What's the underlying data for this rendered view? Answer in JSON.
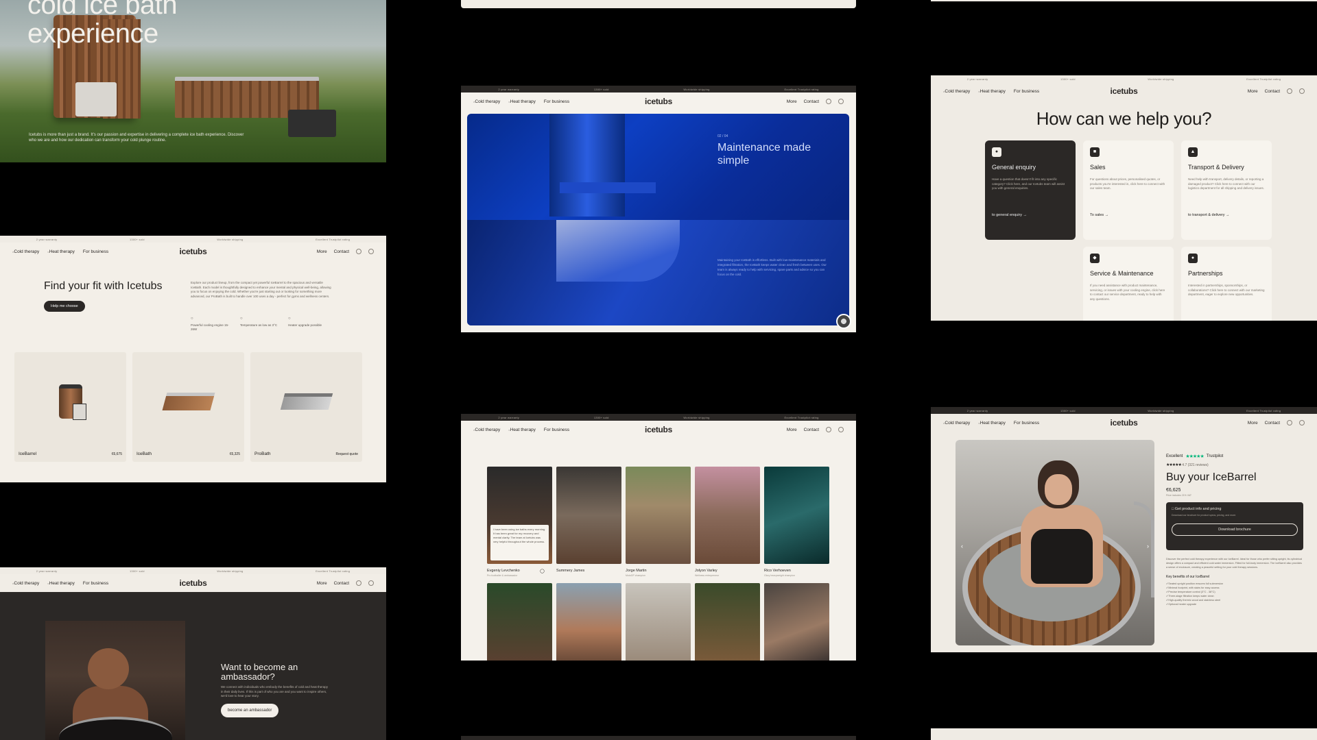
{
  "topbar": [
    "2 year warranty",
    "1300+ sold",
    "Worldwide shipping",
    "Excellent Trustpilot rating"
  ],
  "nav": {
    "left": [
      "Cold therapy",
      "Heat therapy",
      "For business"
    ],
    "logo": "icetubs",
    "right": [
      "More",
      "Contact"
    ]
  },
  "hero": {
    "title": "cold ice bath\nexperience",
    "caption": "Icetubs is more than just a brand. It's our passion and expertise in delivering a complete ice bath experience. Discover who we are and how our dedication can transform your cold plunge routine."
  },
  "maintenance": {
    "eyebrow": "02 / 04",
    "heading": "Maintenance made simple",
    "body": "Maintaining your IceBath is effortless. Built with low-maintenance materials and integrated filtration, the IceBath keeps water clean and fresh between uses. Our team is always ready to help with servicing, spare parts and advice so you can focus on the cold."
  },
  "help": {
    "heading": "How can we help you?",
    "cards": [
      {
        "icon": "chat-icon",
        "title": "General enquiry",
        "body": "Have a question that doesn't fit into any specific category? Click here, and our Icetubs team will assist you with general enquiries.",
        "link": "to general enquiry →"
      },
      {
        "icon": "cart-icon",
        "title": "Sales",
        "body": "For questions about prices, personalised quotes, or products you're interested in, click here to connect with our sales team.",
        "link": "To sales →"
      },
      {
        "icon": "truck-icon",
        "title": "Transport & Delivery",
        "body": "Need help with transport, delivery details, or reporting a damaged product? Click here to connect with our logistics department for all shipping and delivery issues.",
        "link": "to transport & delivery →"
      },
      {
        "icon": "wrench-icon",
        "title": "Service & Maintenance",
        "body": "If you need assistance with product maintenance, servicing, or issues with your cooling engine, click here to contact our service department, ready to help with any questions.",
        "link": ""
      },
      {
        "icon": "handshake-icon",
        "title": "Partnerships",
        "body": "Interested in partnerships, sponsorships, or collaborations? Click here to connect with our marketing department, eager to explore new opportunities.",
        "link": ""
      }
    ]
  },
  "fit": {
    "heading": "Find your fit with Icetubs",
    "button": "Help me choose",
    "paragraph": "Explore our product lineup, from the compact yet powerful IceBarrel to the spacious and versatile IceBath. Each model is thoughtfully designed to enhance your mental and physical well-being, allowing you to focus on enjoying the cold. Whether you're just starting out or looking for something more advanced, our ProBath is built to handle over 100 uses a day - perfect for gyms and wellness centers.",
    "features": [
      "Powerful cooling engine 15-26W",
      "Temperature as low as 3°C",
      "Heater upgrade possible"
    ],
    "products": [
      {
        "name": "IceBarrel",
        "price": "€6,675"
      },
      {
        "name": "IceBath",
        "price": "€6,325"
      },
      {
        "name": "ProBath",
        "price": "Request quote"
      }
    ]
  },
  "ambassador": {
    "heading": "Want to become an ambassador?",
    "text": "We connect with individuals who embody the benefits of cold and heat therapy in their daily lives. If this is part of who you are and you want to inspire others, we'd love to hear your story.",
    "button": "become an ambassador"
  },
  "gallery": {
    "quote": "I have been using ice baths every morning. It has been great for my recovery and mental clarity. The team at Icetubs was very helpful throughout the whole process.",
    "people": [
      {
        "name": "Evgeniy Levchenko",
        "role": "Pro footballer & ambassador"
      },
      {
        "name": "Summery James",
        "role": ""
      },
      {
        "name": "Jorge Martin",
        "role": "MotoGP champion"
      },
      {
        "name": "Jolyon Varley",
        "role": "Wellness entrepreneur"
      },
      {
        "name": "Rico Verhoeven",
        "role": "Glory heavyweight champion"
      }
    ]
  },
  "buy": {
    "rating_label": "Excellent",
    "trustpilot": "Trustpilot",
    "reviews": "4.7 (321 reviews)",
    "heading": "Buy your IceBarrel",
    "price": "€6,625",
    "price_note": "Price includes 21% VAT",
    "info_title": "Get product info and pricing",
    "info_sub": "Download our brochure for product specs, pricing, and more.",
    "download": "Download brochure",
    "description": "Discover the perfect cold therapy experience with our IceBarrel. Ideal for those who prefer sitting upright, its cylindrical design offers a compact and efficient cold water immersion. Fitted for full-body immersion. The IceBarrel also provides a sense of enclosure, creating a peaceful setting for your cold therapy sessions.",
    "benefits_title": "Key benefits of our IceBarrel",
    "benefits": [
      "Seated upright position ensures full submersion",
      "Minimal footprint, with stairs for easy access",
      "Precise temperature control (3°C - 38°C)",
      "Three-stage filtration keeps water clean",
      "High-quality thermic wood and stainless steel",
      "Optional heater upgrade"
    ]
  },
  "colors": {
    "dark": "#2b2826",
    "cream": "#f1ede6",
    "blue": "#0d3fc2",
    "trustpilot": "#00b67a"
  }
}
